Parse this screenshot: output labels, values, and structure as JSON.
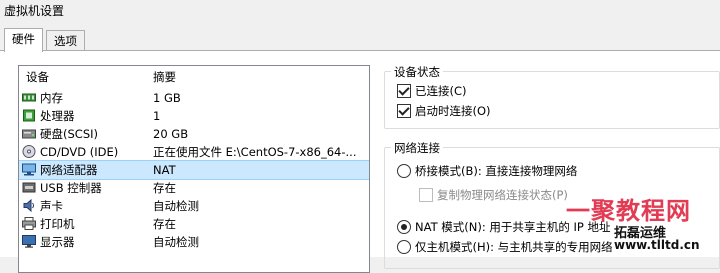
{
  "window": {
    "title": "虚拟机设置"
  },
  "tabs": [
    {
      "label": "硬件"
    },
    {
      "label": "选项"
    }
  ],
  "device_list": {
    "headers": {
      "device": "设备",
      "summary": "摘要"
    },
    "rows": [
      {
        "name": "内存",
        "summary": "1 GB",
        "icon": "memory-icon"
      },
      {
        "name": "处理器",
        "summary": "1",
        "icon": "processor-icon"
      },
      {
        "name": "硬盘(SCSI)",
        "summary": "20 GB",
        "icon": "hard-disk-icon"
      },
      {
        "name": "CD/DVD (IDE)",
        "summary": "正在使用文件 E:\\CentOS-7-x86_64-...",
        "icon": "cd-dvd-icon"
      },
      {
        "name": "网络适配器",
        "summary": "NAT",
        "icon": "network-adapter-icon"
      },
      {
        "name": "USB 控制器",
        "summary": "存在",
        "icon": "usb-icon"
      },
      {
        "name": "声卡",
        "summary": "自动检测",
        "icon": "sound-card-icon"
      },
      {
        "name": "打印机",
        "summary": "存在",
        "icon": "printer-icon"
      },
      {
        "name": "显示器",
        "summary": "自动检测",
        "icon": "display-icon"
      }
    ],
    "selected_index": 4
  },
  "device_status": {
    "title": "设备状态",
    "connected": {
      "label": "已连接(C)",
      "checked": true
    },
    "connect_at_power_on": {
      "label": "启动时连接(O)",
      "checked": true
    }
  },
  "network_connection": {
    "title": "网络连接",
    "bridged": {
      "label": "桥接模式(B): 直接连接物理网络",
      "checked": false
    },
    "replicate": {
      "label": "复制物理网络连接状态(P)",
      "checked": false,
      "disabled": true
    },
    "nat": {
      "label": "NAT 模式(N): 用于共享主机的 IP 地址",
      "checked": true
    },
    "host_only": {
      "label": "仅主机模式(H): 与主机共享的专用网络",
      "checked": false
    }
  },
  "watermark": {
    "brand": "一聚教程网",
    "name": "拓磊运维",
    "url": "www.tlltd.cn"
  }
}
